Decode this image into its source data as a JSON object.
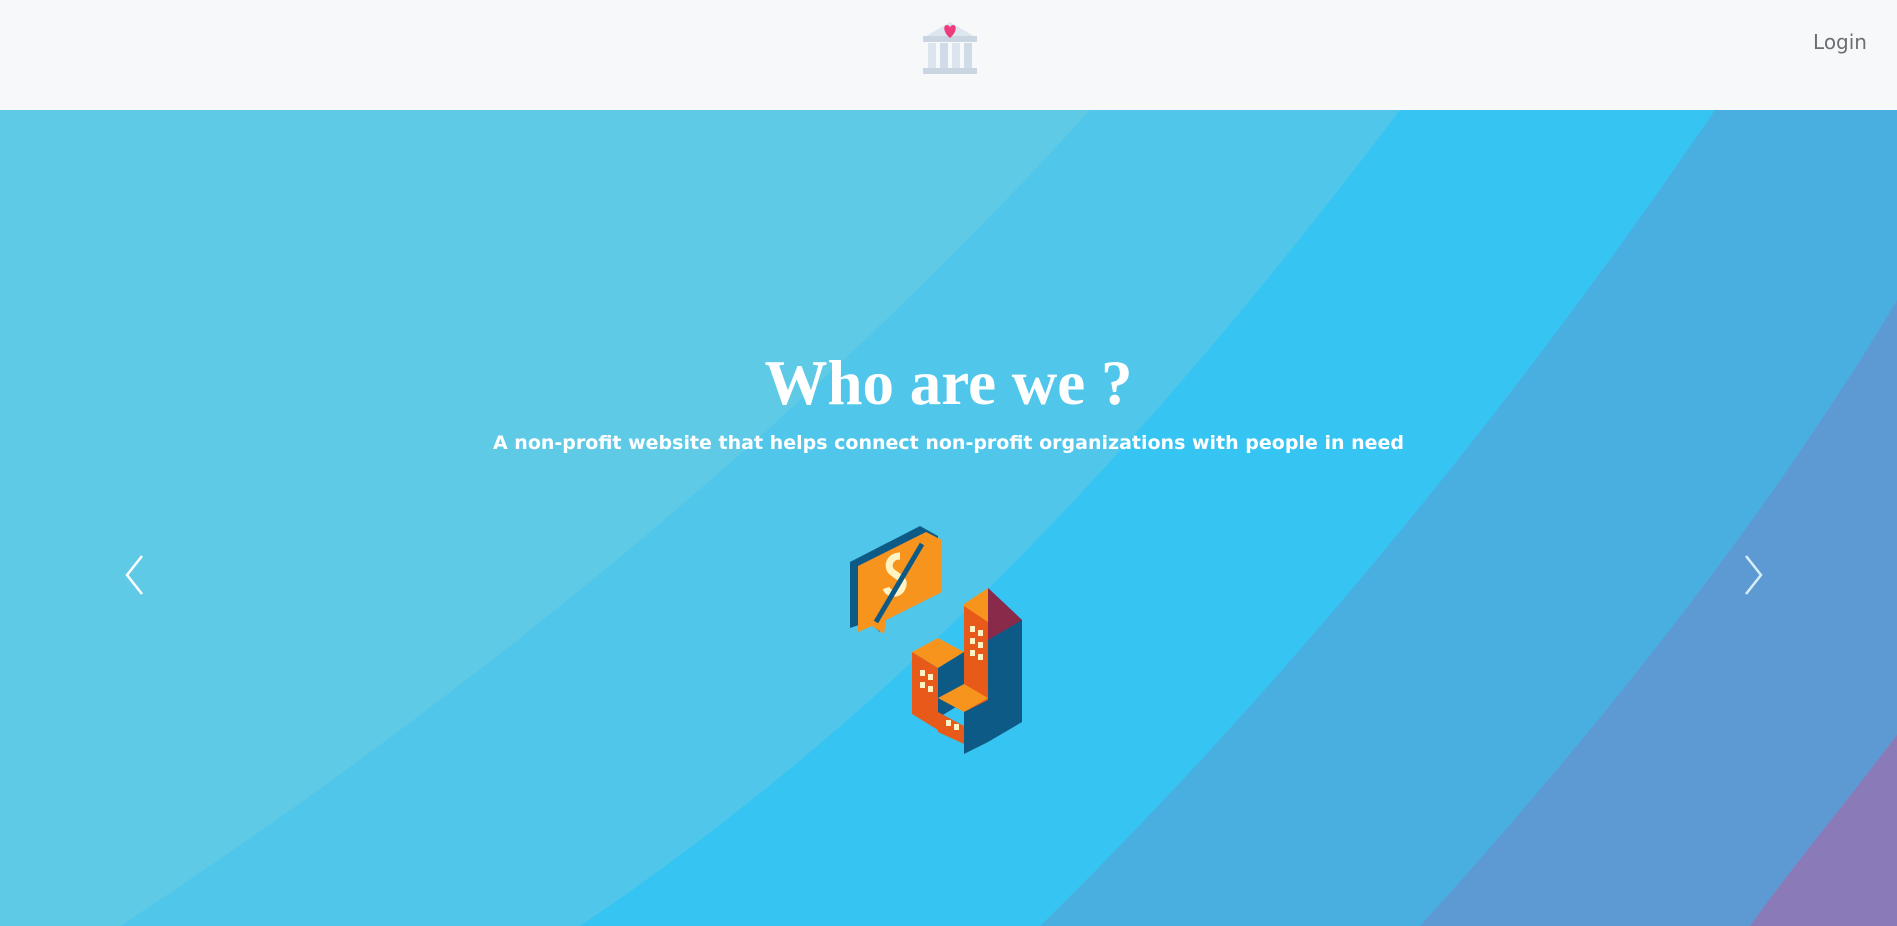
{
  "nav": {
    "logo_icon": "charity-building-heart-icon",
    "login_label": "Login"
  },
  "hero": {
    "title": "Who are we ?",
    "subtitle": "A non-profit website that helps connect non-profit organizations with people in need",
    "prev_icon": "chevron-left-icon",
    "next_icon": "chevron-right-icon",
    "illustration_icon": "city-buildings-currency-bubble-icon"
  },
  "colors": {
    "navbar_bg": "#f7f8fa",
    "hero_base": "#5ecae6",
    "hero_band_2": "#4fc5eb",
    "hero_band_3": "#35c3f2",
    "hero_band_4": "#4aaee0",
    "hero_band_5": "#5e9ad3",
    "hero_band_6": "#8a7ab8",
    "text_white": "#ffffff",
    "login_text": "#6b6f73"
  }
}
